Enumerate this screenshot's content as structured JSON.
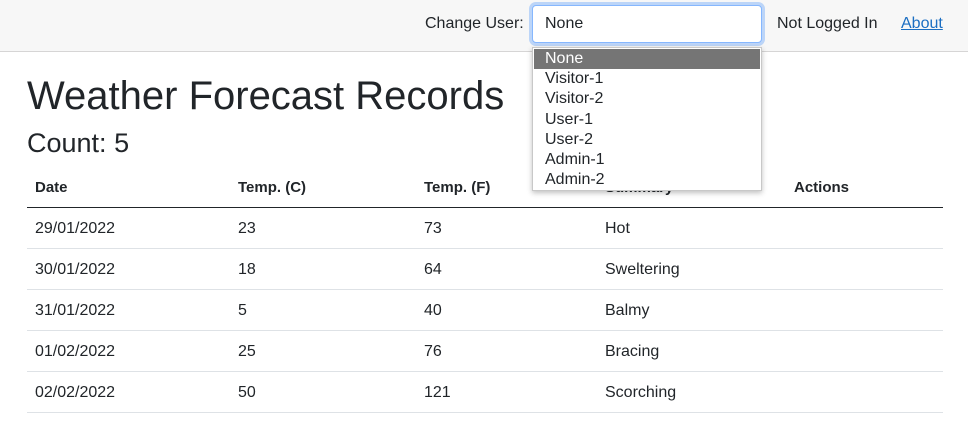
{
  "header": {
    "change_user_label": "Change User:",
    "selected_user": "None",
    "login_status": "Not Logged In",
    "about_link": "About"
  },
  "user_options": [
    "None",
    "Visitor-1",
    "Visitor-2",
    "User-1",
    "User-2",
    "Admin-1",
    "Admin-2"
  ],
  "page": {
    "title": "Weather Forecast Records",
    "count_label": "Count:",
    "count_value": "5"
  },
  "table": {
    "headers": [
      "Date",
      "Temp. (C)",
      "Temp. (F)",
      "Summary",
      "Actions"
    ],
    "rows": [
      [
        "29/01/2022",
        "23",
        "73",
        "Hot",
        ""
      ],
      [
        "30/01/2022",
        "18",
        "64",
        "Sweltering",
        ""
      ],
      [
        "31/01/2022",
        "5",
        "40",
        "Balmy",
        ""
      ],
      [
        "01/02/2022",
        "25",
        "76",
        "Bracing",
        ""
      ],
      [
        "02/02/2022",
        "50",
        "121",
        "Scorching",
        ""
      ]
    ]
  },
  "colors": {
    "topbar_bg": "#f7f7f7",
    "link": "#1b6ec2",
    "selected_option_bg": "#757575",
    "focus_ring": "#86b7fe"
  }
}
